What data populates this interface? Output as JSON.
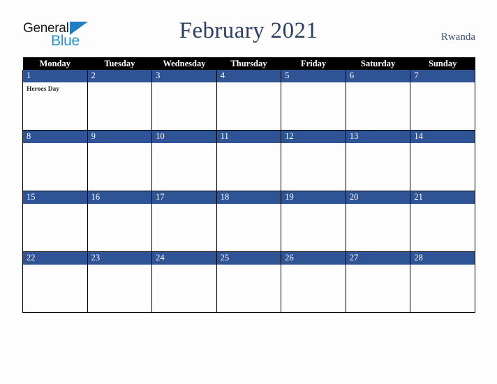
{
  "logo": {
    "word1": "General",
    "word2": "Blue",
    "triangle_color": "#1f7ec4",
    "word2_color": "#2392d6"
  },
  "header": {
    "title": "February 2021",
    "country": "Rwanda",
    "title_color": "#2c3f66"
  },
  "calendar": {
    "weekday_headers": [
      "Monday",
      "Tuesday",
      "Wednesday",
      "Thursday",
      "Friday",
      "Saturday",
      "Sunday"
    ],
    "header_bg": "#000000",
    "daynum_bg": "#2e5496",
    "weeks": [
      [
        {
          "day": "1",
          "events": [
            "Heroes Day"
          ]
        },
        {
          "day": "2",
          "events": []
        },
        {
          "day": "3",
          "events": []
        },
        {
          "day": "4",
          "events": []
        },
        {
          "day": "5",
          "events": []
        },
        {
          "day": "6",
          "events": []
        },
        {
          "day": "7",
          "events": []
        }
      ],
      [
        {
          "day": "8",
          "events": []
        },
        {
          "day": "9",
          "events": []
        },
        {
          "day": "10",
          "events": []
        },
        {
          "day": "11",
          "events": []
        },
        {
          "day": "12",
          "events": []
        },
        {
          "day": "13",
          "events": []
        },
        {
          "day": "14",
          "events": []
        }
      ],
      [
        {
          "day": "15",
          "events": []
        },
        {
          "day": "16",
          "events": []
        },
        {
          "day": "17",
          "events": []
        },
        {
          "day": "18",
          "events": []
        },
        {
          "day": "19",
          "events": []
        },
        {
          "day": "20",
          "events": []
        },
        {
          "day": "21",
          "events": []
        }
      ],
      [
        {
          "day": "22",
          "events": []
        },
        {
          "day": "23",
          "events": []
        },
        {
          "day": "24",
          "events": []
        },
        {
          "day": "25",
          "events": []
        },
        {
          "day": "26",
          "events": []
        },
        {
          "day": "27",
          "events": []
        },
        {
          "day": "28",
          "events": []
        }
      ]
    ]
  }
}
